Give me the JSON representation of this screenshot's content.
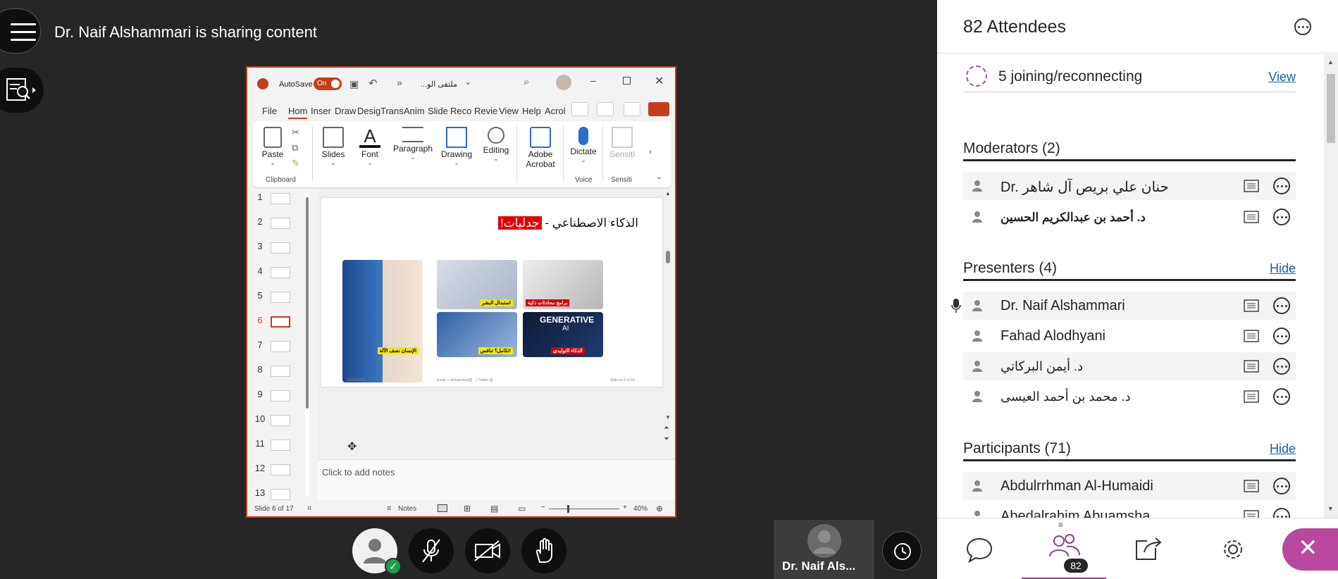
{
  "header": {
    "sharing_text": "Dr. Naif Alshammari is sharing content"
  },
  "powerpoint": {
    "autosave_label": "AutoSave",
    "autosave_state": "On",
    "doc_title": "ملتقى الو...",
    "tabs": [
      "File",
      "Hom",
      "Inser",
      "Draw",
      "Desig",
      "Trans",
      "Anim",
      "Slide",
      "Reco",
      "Revie",
      "View",
      "Help",
      "Acrol"
    ],
    "ribbon": {
      "paste": "Paste",
      "clipboard": "Clipboard",
      "slides": "Slides",
      "font": "Font",
      "paragraph": "Paragraph",
      "drawing": "Drawing",
      "editing": "Editing",
      "adobe_acrobat_line1": "Adobe",
      "adobe_acrobat_line2": "Acrobat",
      "dictate": "Dictate",
      "voice": "Voice",
      "sensitivity": "Sensiti",
      "sensitivity_group": "Sensiti"
    },
    "slide_numbers": [
      "1",
      "2",
      "3",
      "4",
      "5",
      "6",
      "7",
      "8",
      "9",
      "10",
      "11",
      "12",
      "13"
    ],
    "active_slide": 6,
    "slide": {
      "title_prefix": "الذكاء الاصطناعي - ",
      "title_highlight": "جدليات!",
      "captions": [
        "الإنسان نصف الآلة",
        "استبدال البشر",
        "برامج محادثات ذكية",
        "تكامل؟ تنافس!",
        "الذكاء التوليدي"
      ],
      "generative_label": "GENERATIVE",
      "ai_label": "AI",
      "footer_date": "10/30/2024",
      "footer_email": "Email: n.alshammari@... | Twitter @...",
      "footer_page": "Slide no 6 of 16"
    },
    "notes_placeholder": "Click to add notes",
    "status": {
      "slide_of": "Slide 6 of 17",
      "notes": "Notes",
      "zoom": "40%"
    }
  },
  "self_tile": {
    "name": "Dr. Naif Als..."
  },
  "panel": {
    "attendee_count_label": "82 Attendees",
    "joining_text": "5 joining/reconnecting",
    "joining_link": "View",
    "sections": [
      {
        "title": "Moderators (2)",
        "link": "",
        "members": [
          "Dr. حنان علي بريص آل شاهر",
          "د. أحمد بن عبدالكريم الحسين"
        ]
      },
      {
        "title": "Presenters (4)",
        "link": "Hide",
        "members": [
          "Dr. Naif Alshammari",
          "Fahad Alodhyani",
          "د. أيمن البركاتي",
          "د. محمد بن أحمد العيسى"
        ]
      },
      {
        "title": "Participants (71)",
        "link": "Hide",
        "members": [
          "Abdulrrhman Al-Humaidi",
          "Abedalrahim Abuamsha"
        ]
      }
    ],
    "tabs": [
      "chat-icon",
      "attendees-icon",
      "share-icon",
      "settings-icon",
      "close-icon"
    ],
    "attendee_badge": "82"
  },
  "colors": {
    "background": "#262626",
    "ppt_accent": "#c43e1c",
    "link": "#1a5f9e",
    "active_tab": "#8b3c8f",
    "close_button": "#b9489e"
  }
}
